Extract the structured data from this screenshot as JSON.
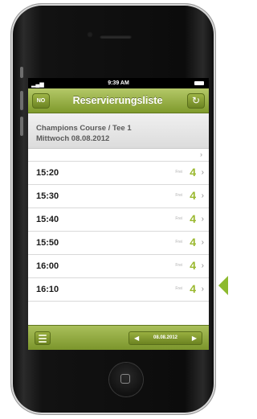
{
  "status_bar": {
    "signal": "▂▄▆",
    "time": "9:39 AM"
  },
  "navbar": {
    "left_button": "NO",
    "title": "Reservierungsliste",
    "refresh_icon": "refresh-icon"
  },
  "header": {
    "line1": "Champions Course / Tee 1",
    "line2": "Mittwoch 08.08.2012"
  },
  "rows": [
    {
      "time": "15:20",
      "small": "Frei",
      "count": "4"
    },
    {
      "time": "15:30",
      "small": "Frei",
      "count": "4"
    },
    {
      "time": "15:40",
      "small": "Frei",
      "count": "4"
    },
    {
      "time": "15:50",
      "small": "Frei",
      "count": "4"
    },
    {
      "time": "16:00",
      "small": "Frei",
      "count": "4"
    },
    {
      "time": "16:10",
      "small": "Frei",
      "count": "4"
    }
  ],
  "toolbar": {
    "date": "08.08.2012",
    "prev_icon": "◀",
    "next_icon": "▶"
  },
  "colors": {
    "accent": "#8dba2f",
    "nav": "#8fa838"
  }
}
